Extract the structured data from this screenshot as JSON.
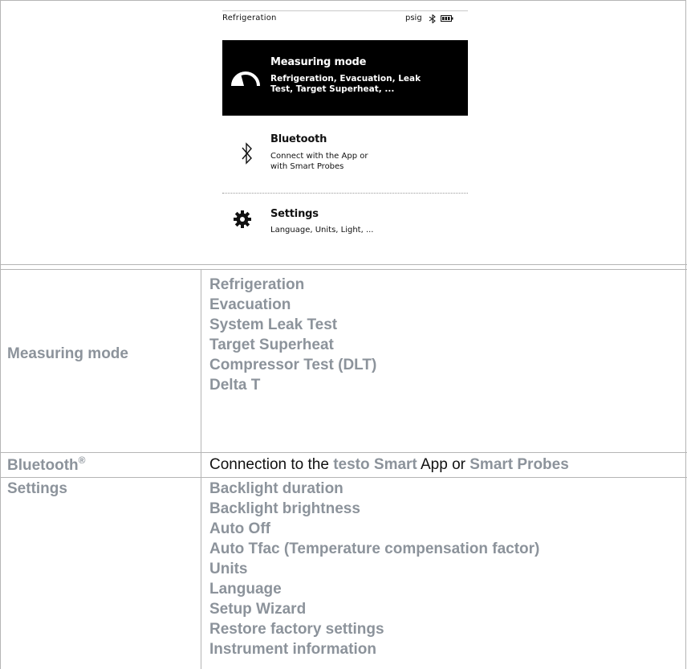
{
  "device": {
    "status": {
      "title": "Refrigeration",
      "unit": "psig"
    },
    "menu": [
      {
        "title": "Measuring mode",
        "desc1": "Refrigeration, Evacuation, Leak",
        "desc2": "Test, Target Superheat, ...",
        "icon": "gauge-icon"
      },
      {
        "title": "Bluetooth",
        "desc1": "Connect with the App or",
        "desc2": "with Smart Probes",
        "icon": "bluetooth-icon"
      },
      {
        "title": "Settings",
        "desc1": "Language, Units, Light, ...",
        "icon": "gear-icon"
      }
    ]
  },
  "table": {
    "rows": [
      {
        "label": "Measuring mode",
        "items": [
          "Refrigeration",
          "Evacuation",
          "System Leak Test",
          "Target Superheat",
          "Compressor Test (DLT)",
          "Delta T"
        ]
      },
      {
        "label": "Bluetooth",
        "label_sup": "®",
        "desc": {
          "pre": "Connection to the ",
          "hl1": "testo Smart",
          "mid": " App or ",
          "hl2": "Smart Probes"
        }
      },
      {
        "label": "Settings",
        "items": [
          "Backlight duration",
          "Backlight brightness",
          "Auto Off",
          "Auto Tfac (Temperature compensation factor)",
          "Units",
          "Language",
          "Setup Wizard",
          "Restore factory settings",
          "Instrument information"
        ]
      }
    ]
  }
}
